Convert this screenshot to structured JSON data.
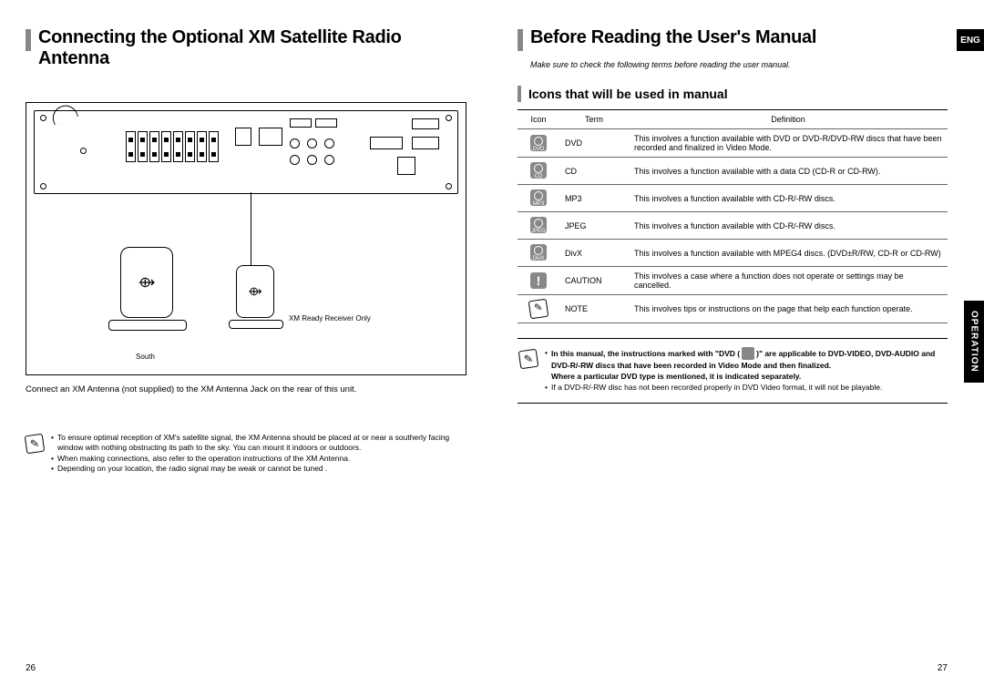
{
  "left": {
    "title": "Connecting the Optional XM Satellite Radio Antenna",
    "diagram": {
      "xm_ready_label": "XM Ready Receiver Only",
      "south_label": "South"
    },
    "connect_text": "Connect an XM Antenna (not supplied) to the XM Antenna Jack on the rear of this unit.",
    "notes": [
      "To ensure optimal reception of XM's satellite signal, the XM Antenna should be placed at or near a southerly facing window with nothing obstructing its path to the sky. You can mount it indoors or outdoors.",
      "When making connections, also refer to the operation instructions of the XM Antenna.",
      "Depending on your location, the radio signal may be weak or cannot be tuned ."
    ],
    "page_number": "26"
  },
  "right": {
    "title": "Before Reading the User's Manual",
    "intro": "Make sure to check the following terms before reading the user manual.",
    "subtitle": "Icons that will be used in manual",
    "table_headers": {
      "icon": "Icon",
      "term": "Term",
      "definition": "Definition"
    },
    "rows": [
      {
        "icon_label": "DVD",
        "term": "DVD",
        "definition": "This involves a function available with DVD or DVD-R/DVD-RW discs that have been recorded and finalized in Video Mode."
      },
      {
        "icon_label": "CD",
        "term": "CD",
        "definition": "This involves a function available with a data CD (CD-R or CD-RW)."
      },
      {
        "icon_label": "MP3",
        "term": "MP3",
        "definition": "This involves a function available with CD-R/-RW discs."
      },
      {
        "icon_label": "JPEG",
        "term": "JPEG",
        "definition": "This involves a function available with CD-R/-RW discs."
      },
      {
        "icon_label": "DivX",
        "term": "DivX",
        "definition": "This involves a function available with MPEG4 discs. (DVD±R/RW, CD-R or CD-RW)"
      },
      {
        "icon_label": "!",
        "term": "CAUTION",
        "definition": "This involves a case where a function does not operate or settings may be cancelled."
      },
      {
        "icon_label": "✎",
        "term": "NOTE",
        "definition": "This involves tips or instructions on the page that help each function operate."
      }
    ],
    "notes2": {
      "bold_pre": "In this manual, the instructions marked with \"DVD (",
      "bold_post": ")\" are applicable to DVD-VIDEO, DVD-AUDIO and DVD-R/-RW discs that have been recorded in Video Mode and then finalized.",
      "bold_line2": "Where a particular DVD type is mentioned, it is indicated separately.",
      "plain": "If a DVD-R/-RW disc has not been recorded properly in DVD Video format, it will not be playable."
    },
    "page_number": "27",
    "lang_tab": "ENG",
    "side_tab": "OPERATION"
  }
}
